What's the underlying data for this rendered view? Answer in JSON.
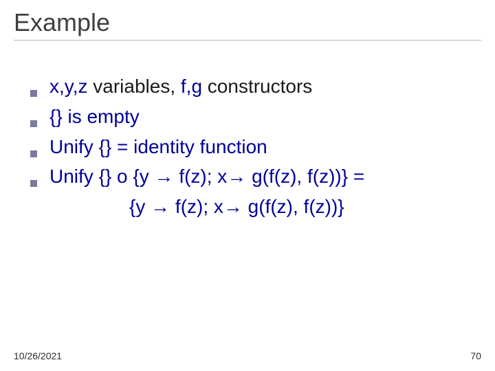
{
  "title": "Example",
  "bullets": {
    "b1_pre": "x,y,z",
    "b1_mid": " variables, ",
    "b1_fg": "f,g",
    "b1_post": " constructors",
    "b2": "{} is empty",
    "b3": "Unify {} = identity function",
    "b4": "Unify {} o {y → f(z); x→ g(f(z), f(z))} =",
    "b4_cont": "{y → f(z); x→ g(f(z), f(z))}"
  },
  "footer": {
    "date": "10/26/2021",
    "page": "70"
  }
}
